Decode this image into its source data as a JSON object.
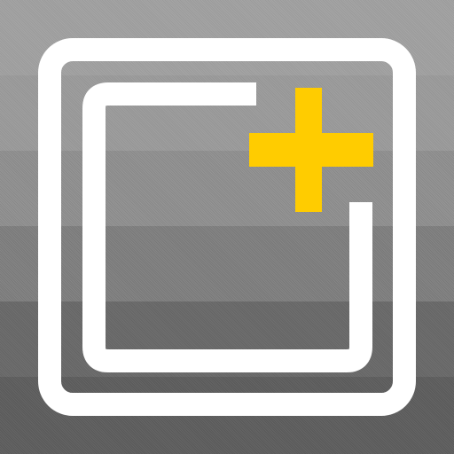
{
  "app_icon": {
    "name": "add-frame-icon",
    "colors": {
      "frame": "#ffffff",
      "plus": "#ffcc00"
    }
  }
}
